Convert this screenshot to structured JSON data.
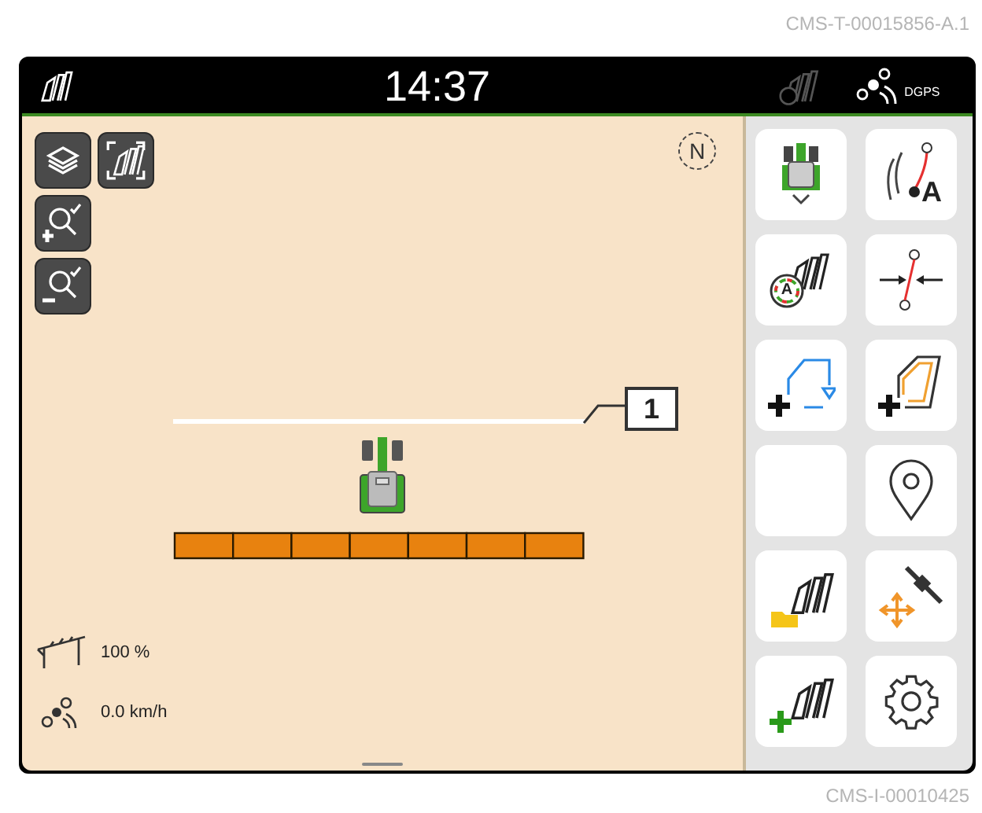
{
  "document_code": "CMS-T-00015856-A.1",
  "status_bar": {
    "time": "14:37",
    "gps_label": "DGPS"
  },
  "map": {
    "compass": "N",
    "callout": "1",
    "readings": [
      {
        "kind": "boom",
        "text": "100 %"
      },
      {
        "kind": "speed",
        "text": "0.0 km/h"
      }
    ]
  },
  "side_panel": {
    "track_letter": "A",
    "guidance_letter": "A"
  },
  "image_code": "CMS-I-00010425"
}
